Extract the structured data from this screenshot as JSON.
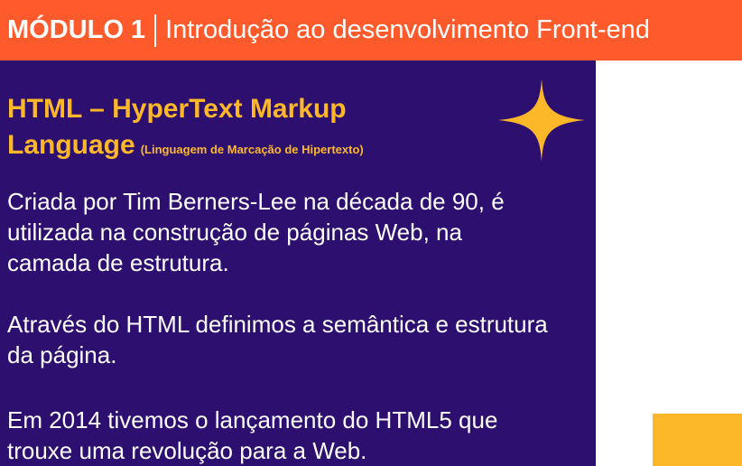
{
  "header": {
    "module": "MÓDULO 1",
    "topic": "Introdução ao desenvolvimento Front-end"
  },
  "slide": {
    "title": "HTML – HyperText Markup Language",
    "subtitle": "(Linguagem de Marcação de Hipertexto)",
    "paragraphs": [
      "Criada por Tim Berners-Lee na década de 90, é utilizada na construção de páginas Web, na camada de estrutura.",
      "Através do HTML definimos a semântica e estrutura da página.",
      "Em 2014 tivemos o lançamento do HTML5 que trouxe uma revolução para a Web."
    ],
    "decoration_icon": "four-point-star-icon"
  },
  "colors": {
    "header_bg": "#fe5a2c",
    "panel_bg": "#2c0f6e",
    "accent": "#fdb82a",
    "text": "#ffffff"
  }
}
